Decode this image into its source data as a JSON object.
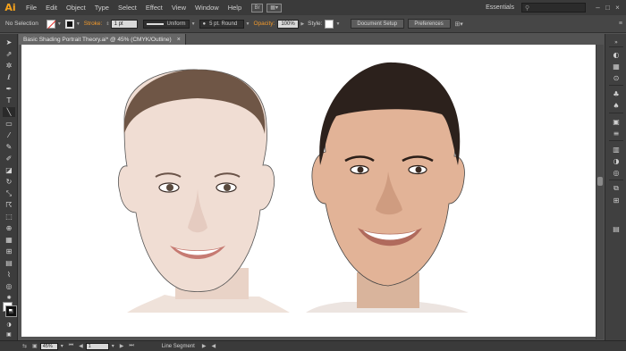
{
  "app": {
    "logo": "Ai",
    "brand_color": "#f7a31c"
  },
  "menu": [
    "File",
    "Edit",
    "Object",
    "Type",
    "Select",
    "Effect",
    "View",
    "Window",
    "Help"
  ],
  "menubar": {
    "bridge_label": "Br",
    "workspace": "Essentials",
    "search_icon": "search-icon"
  },
  "control": {
    "selection": "No Selection",
    "stroke_label": "Stroke:",
    "stroke_value": "1 pt",
    "profile_label": "Uniform",
    "brush_label": "5 pt. Round",
    "opacity_label": "Opacity:",
    "opacity_value": "100%",
    "style_label": "Style:",
    "document_setup": "Document Setup",
    "preferences": "Preferences"
  },
  "document": {
    "tab_title": "Basic Shading Portrait Theory.ai* @ 45% (CMYK/Outline)",
    "close": "×"
  },
  "status": {
    "zoom": "45%",
    "artboard": "1",
    "tool_name": "Line Segment"
  },
  "tools": [
    "selection-tool-icon",
    "direct-selection-tool-icon",
    "magic-wand-tool-icon",
    "lasso-tool-icon",
    "pen-tool-icon",
    "type-tool-icon",
    "line-segment-tool-icon",
    "rectangle-tool-icon",
    "paintbrush-tool-icon",
    "pencil-tool-icon",
    "blob-brush-tool-icon",
    "eraser-tool-icon",
    "rotate-tool-icon",
    "scale-tool-icon",
    "warp-tool-icon",
    "free-transform-tool-icon",
    "shape-builder-tool-icon",
    "perspective-grid-tool-icon",
    "mesh-tool-icon",
    "gradient-tool-icon",
    "eyedropper-tool-icon",
    "blend-tool-icon",
    "symbol-sprayer-tool-icon",
    "column-graph-tool-icon",
    "artboard-tool-icon",
    "slice-tool-icon",
    "hand-tool-icon",
    "zoom-tool-icon"
  ],
  "panel_icons": [
    "color-panel-icon",
    "color-guide-icon",
    "swatches-icon",
    "brushes-icon",
    "symbols-icon",
    "graphic-styles-icon",
    "stroke-panel-icon",
    "gradient-panel-icon",
    "transparency-icon",
    "appearance-icon",
    "layers-icon",
    "artboards-icon"
  ]
}
